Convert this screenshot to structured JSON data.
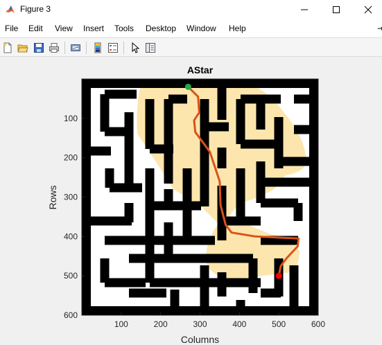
{
  "window": {
    "title": "Figure 3",
    "icon": "matlab-logo-icon",
    "controls": [
      "minimize-icon",
      "maximize-icon",
      "close-icon"
    ]
  },
  "menubar": {
    "items": [
      "File",
      "Edit",
      "View",
      "Insert",
      "Tools",
      "Desktop",
      "Window",
      "Help"
    ],
    "overflow": "⇥"
  },
  "toolbar": {
    "buttons": [
      "new-figure-icon",
      "open-file-icon",
      "save-icon",
      "print-icon",
      "link-plot-icon",
      "insert-colorbar-icon",
      "insert-legend-icon",
      "edit-plot-arrow-icon",
      "property-inspector-icon"
    ]
  },
  "colors": {
    "maze_wall": "#000000",
    "explored": "#fde6ad",
    "path": "#d95319",
    "start": "#22aa44",
    "goal": "#ff0000"
  },
  "chart_data": {
    "type": "maze-path-plot",
    "title": "AStar",
    "xlabel": "Columns",
    "ylabel": "Rows",
    "xlim": [
      0,
      600
    ],
    "ylim": [
      0,
      600
    ],
    "y_reversed": true,
    "xticks": [
      100,
      200,
      300,
      400,
      500,
      600
    ],
    "yticks": [
      100,
      200,
      300,
      400,
      500,
      600
    ],
    "start": [
      270,
      20
    ],
    "goal": [
      500,
      500
    ],
    "path": [
      [
        270,
        20
      ],
      [
        295,
        45
      ],
      [
        298,
        85
      ],
      [
        285,
        105
      ],
      [
        288,
        135
      ],
      [
        325,
        185
      ],
      [
        350,
        260
      ],
      [
        352,
        320
      ],
      [
        365,
        370
      ],
      [
        380,
        390
      ],
      [
        440,
        400
      ],
      [
        550,
        405
      ],
      [
        548,
        425
      ],
      [
        520,
        455
      ],
      [
        505,
        475
      ],
      [
        500,
        500
      ]
    ]
  }
}
